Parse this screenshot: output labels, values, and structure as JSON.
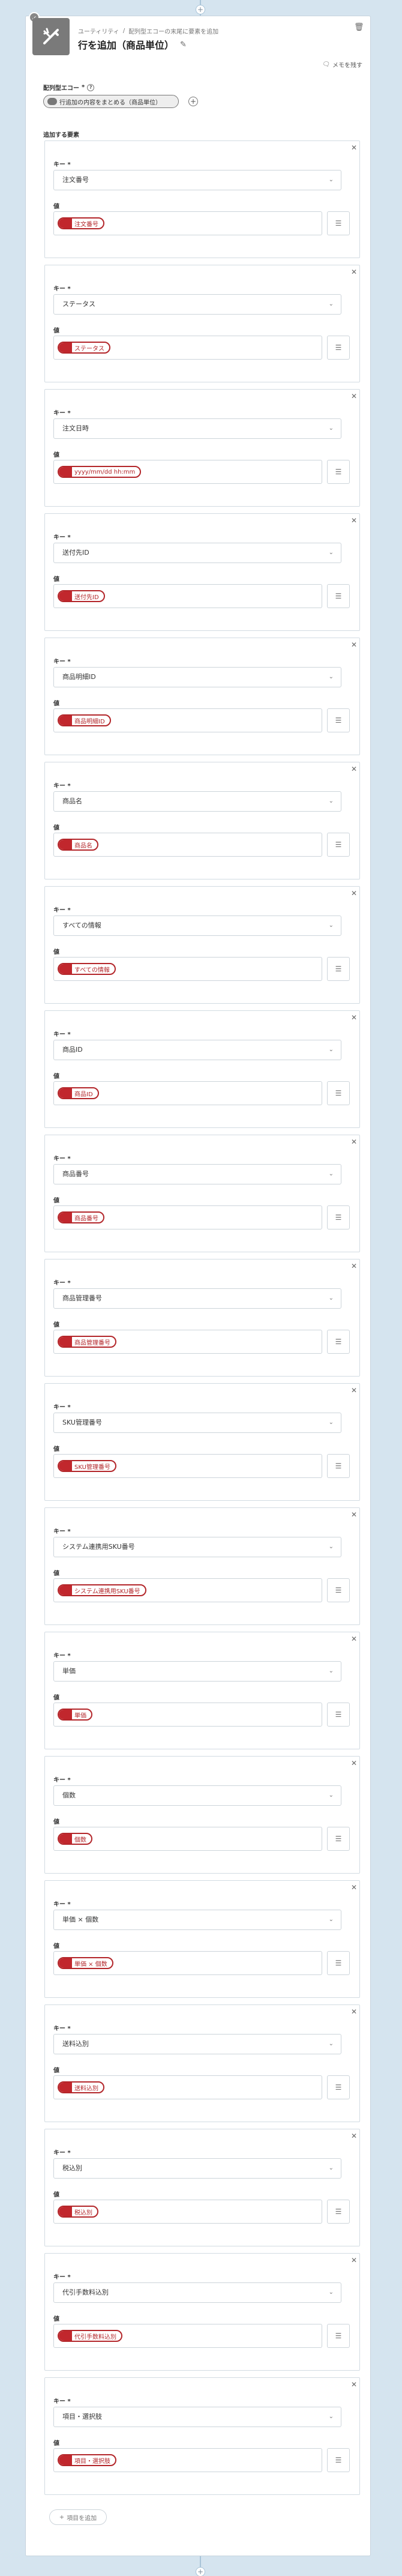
{
  "header": {
    "breadcrumb": [
      "ユーティリティ",
      "配列型エコーの末尾に要素を追加"
    ],
    "title": "行を追加（商品単位）",
    "memo_label": "メモを残す"
  },
  "array_echo": {
    "label": "配列型エコー",
    "required_mark": "*",
    "value": "行追加の内容をまとめる（商品単位）"
  },
  "items_section": {
    "label": "追加する要素",
    "key_label": "キー *",
    "value_label": "値",
    "items": [
      {
        "key": "注文番号",
        "value": "注文番号"
      },
      {
        "key": "ステータス",
        "value": "ステータス"
      },
      {
        "key": "注文日時",
        "value": "yyyy/mm/dd hh:mm"
      },
      {
        "key": "送付先ID",
        "value": "送付先ID"
      },
      {
        "key": "商品明細ID",
        "value": "商品明細ID"
      },
      {
        "key": "商品名",
        "value": "商品名"
      },
      {
        "key": "すべての情報",
        "value": "すべての情報"
      },
      {
        "key": "商品ID",
        "value": "商品ID"
      },
      {
        "key": "商品番号",
        "value": "商品番号"
      },
      {
        "key": "商品管理番号",
        "value": "商品管理番号"
      },
      {
        "key": "SKU管理番号",
        "value": "SKU管理番号"
      },
      {
        "key": "システム連携用SKU番号",
        "value": "システム連携用SKU番号"
      },
      {
        "key": "単価",
        "value": "単価"
      },
      {
        "key": "個数",
        "value": "個数"
      },
      {
        "key": "単価 × 個数",
        "value": "単価 × 個数"
      },
      {
        "key": "送料込別",
        "value": "送料込別"
      },
      {
        "key": "税込別",
        "value": "税込別"
      },
      {
        "key": "代引手数料込別",
        "value": "代引手数料込別"
      },
      {
        "key": "項目・選択肢",
        "value": "項目・選択肢"
      }
    ],
    "add_label": "項目を追加"
  },
  "icons": {
    "app": "tools-icon",
    "check": "check-icon",
    "trash": "trash-icon",
    "memo": "memo-icon",
    "close": "close-icon",
    "chevron": "chevron-down-icon",
    "list": "list-icon"
  },
  "colors": {
    "chip_border": "#b3262a",
    "chip_tag": "#c1272d",
    "background": "#d5e4ef"
  }
}
